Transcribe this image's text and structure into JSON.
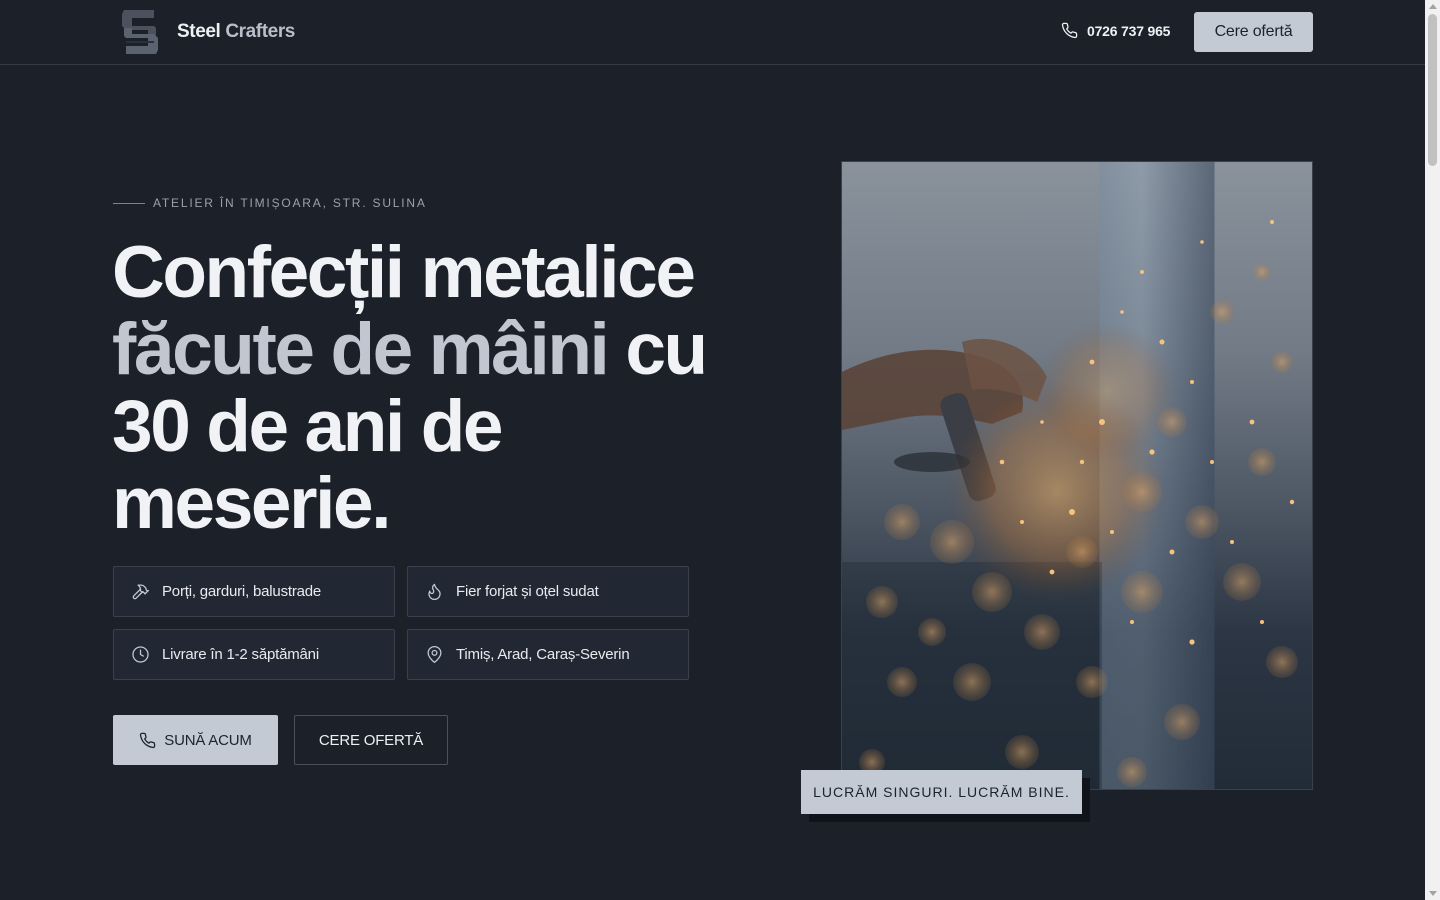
{
  "brand": {
    "name_part1": "Steel",
    "name_part2": "Crafters",
    "logo_icon": "sc-monogram-logo"
  },
  "header": {
    "phone": "0726 737 965",
    "phone_icon": "phone-icon",
    "cta_label": "Cere ofertă"
  },
  "hero": {
    "eyebrow": "ATELIER ÎN TIMIȘOARA, STR. SULINA",
    "title_line1": "Confecții metalice",
    "title_line2_muted": "făcute de mâini",
    "title_line2_rest": " cu",
    "title_line3": "30 de ani de",
    "title_line4": "meserie."
  },
  "features": [
    {
      "label": "Porți, garduri, balustrade",
      "icon": "hammer-icon"
    },
    {
      "label": "Fier forjat și oțel sudat",
      "icon": "flame-icon"
    },
    {
      "label": "Livrare în 1-2 săptămâni",
      "icon": "clock-icon"
    },
    {
      "label": "Timiș, Arad, Caraș-Severin",
      "icon": "map-pin-icon"
    }
  ],
  "actions": {
    "call_label": "SUNĂ ACUM",
    "call_icon": "phone-icon",
    "quote_label": "CERE OFERTĂ"
  },
  "image": {
    "alt": "welding-sparks-photo"
  },
  "badge": {
    "text": "LUCRĂM SINGURI. LUCRĂM BINE."
  },
  "colors": {
    "background": "#1b2029",
    "accent": "#c3cad4",
    "text": "#f0f2f5",
    "muted_text": "#c1c7d0"
  }
}
